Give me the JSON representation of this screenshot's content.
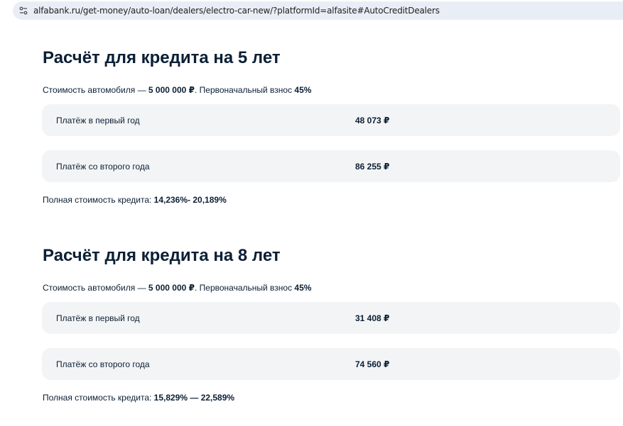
{
  "browser": {
    "url": "alfabank.ru/get-money/auto-loan/dealers/electro-car-new/?platformId=alfasite#AutoCreditDealers",
    "site_info_icon": "tune-icon"
  },
  "sections": [
    {
      "title": "Расчёт для кредита на 5 лет",
      "subtitle_prefix": "Стоимость автомобиля — ",
      "car_price": "5 000 000 ₽",
      "subtitle_middle": ". Первоначальный взнос ",
      "down_payment": "45%",
      "rows": [
        {
          "label": "Платёж в первый год",
          "value": "48 073 ₽"
        },
        {
          "label": "Платёж со второго года",
          "value": "86 255 ₽"
        }
      ],
      "full_cost_label": "Полная стоимость кредита: ",
      "full_cost_value": "14,236%- 20,189%"
    },
    {
      "title": "Расчёт для кредита на 8 лет",
      "subtitle_prefix": "Стоимость автомобиля — ",
      "car_price": "5 000 000 ₽",
      "subtitle_middle": ". Первоначальный взнос ",
      "down_payment": "45%",
      "rows": [
        {
          "label": "Платёж в первый год",
          "value": "31 408 ₽"
        },
        {
          "label": "Платёж со второго года",
          "value": "74 560 ₽"
        }
      ],
      "full_cost_label": "Полная стоимость кредита: ",
      "full_cost_value": "15,829% — 22,589%"
    }
  ]
}
